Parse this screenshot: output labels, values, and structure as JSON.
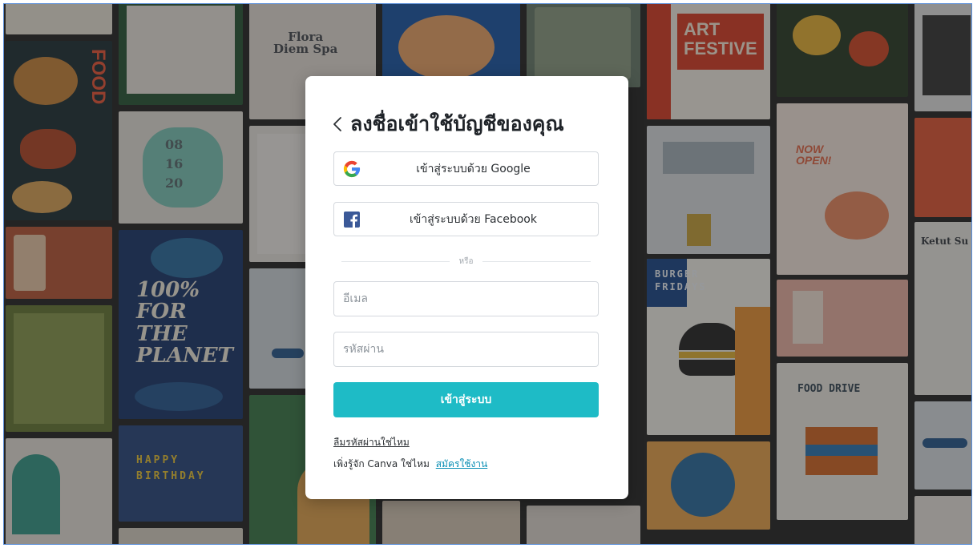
{
  "login": {
    "title": "ลงชื่อเข้าใช้บัญชีของคุณ",
    "google_label": "เข้าสู่ระบบด้วย Google",
    "facebook_label": "เข้าสู่ระบบด้วย Facebook",
    "divider_text": "หรือ",
    "email_placeholder": "อีเมล",
    "email_value": "",
    "password_placeholder": "รหัสผ่าน",
    "password_value": "",
    "submit_label": "เข้าสู่ระบบ",
    "forgot_label": "ลืมรหัสผ่านใช่ไหม",
    "signup_prompt": "เพิ่งรู้จัก Canva ใช่ไหม",
    "signup_link": "สมัครใช้งาน"
  },
  "colors": {
    "primary": "#1ebbc6",
    "link": "#0a8fb5",
    "google_blue": "#4285f4",
    "google_red": "#ea4335",
    "google_yellow": "#fbbc05",
    "google_green": "#34a853",
    "facebook_blue": "#3b5998"
  },
  "icons": {
    "back": "chevron-left-icon",
    "google": "google-icon",
    "facebook": "facebook-icon"
  },
  "background": {
    "tiles": [
      {
        "text": "FOOD"
      },
      {
        "text": "Flora\nDiem Spa"
      },
      {
        "text": "ART\nFESTIVE"
      },
      {
        "text": "08\n16\n20"
      },
      {
        "text": "NOW\nOPEN!"
      },
      {
        "text": "100%\nFOR\nTHE\nPLANET"
      },
      {
        "text": "BURGER\nFRIDAYS"
      },
      {
        "text": "Ketut Su"
      },
      {
        "text": "FOOD DRIVE"
      },
      {
        "text": "HAPPY\nBIRTHDAY"
      }
    ]
  }
}
